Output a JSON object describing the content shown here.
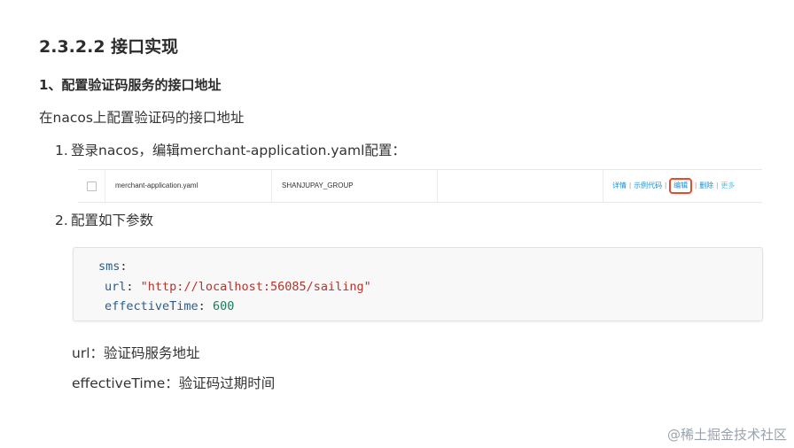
{
  "heading": "2.3.2.2 接口实现",
  "subheading": "1、配置验证码服务的接口地址",
  "intro": "在nacos上配置验证码的接口地址",
  "steps": [
    {
      "num": "1.",
      "text": "登录nacos，编辑merchant-application.yaml配置："
    },
    {
      "num": "2.",
      "text": "配置如下参数"
    }
  ],
  "config_row": {
    "data_id": "merchant-application.yaml",
    "group": "SHANJUPAY_GROUP",
    "ops": {
      "detail": "详情",
      "sample_code": "示例代码",
      "edit": "编辑",
      "delete": "删除",
      "more": "更多",
      "sep": "|"
    }
  },
  "code": {
    "key_sms": "sms",
    "key_url": "url",
    "val_url": "\"http://localhost:56085/sailing\"",
    "key_time": "effectiveTime",
    "val_time": "600",
    "colon": ":"
  },
  "descriptions": [
    "url：验证码服务地址",
    "effectiveTime：验证码过期时间"
  ],
  "watermark": "@稀土掘金技术社区",
  "colors": {
    "highlight_box": "#e84a2a",
    "link": "#1a8fd6",
    "code_string": "#b7332a",
    "code_number": "#1c7b5a",
    "code_key": "#2c5d8b"
  }
}
